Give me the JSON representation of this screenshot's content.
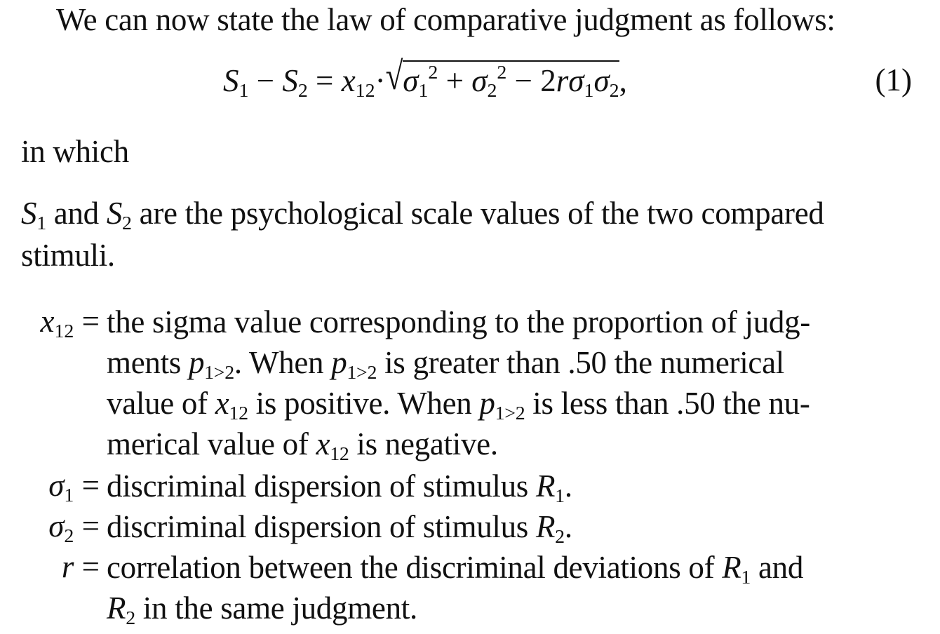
{
  "paragraphs": {
    "intro": "We can now state the law of comparative judgment as follows:",
    "in_which": "in which",
    "s_line1_rest": " are the psychological scale values of the two compared",
    "s_line2": "stimuli."
  },
  "equation": {
    "number": "(1)"
  },
  "definitions": {
    "x12": {
      "line1": "the sigma value corresponding to the proportion of judg-",
      "line2_a": "ments ",
      "line2_b": ". When ",
      "line2_c": " is greater than .50 the numerical",
      "line3_a": "value of ",
      "line3_b": " is positive. When ",
      "line3_c": " is less than .50 the nu-",
      "line4_a": "merical value of ",
      "line4_b": " is negative."
    },
    "sigma1": {
      "text": "discriminal dispersion of stimulus "
    },
    "sigma2": {
      "text": "discriminal dispersion of stimulus "
    },
    "r": {
      "line1": "correlation between the discriminal deviations of ",
      "and": " and",
      "line2": " in the same judgment."
    }
  }
}
